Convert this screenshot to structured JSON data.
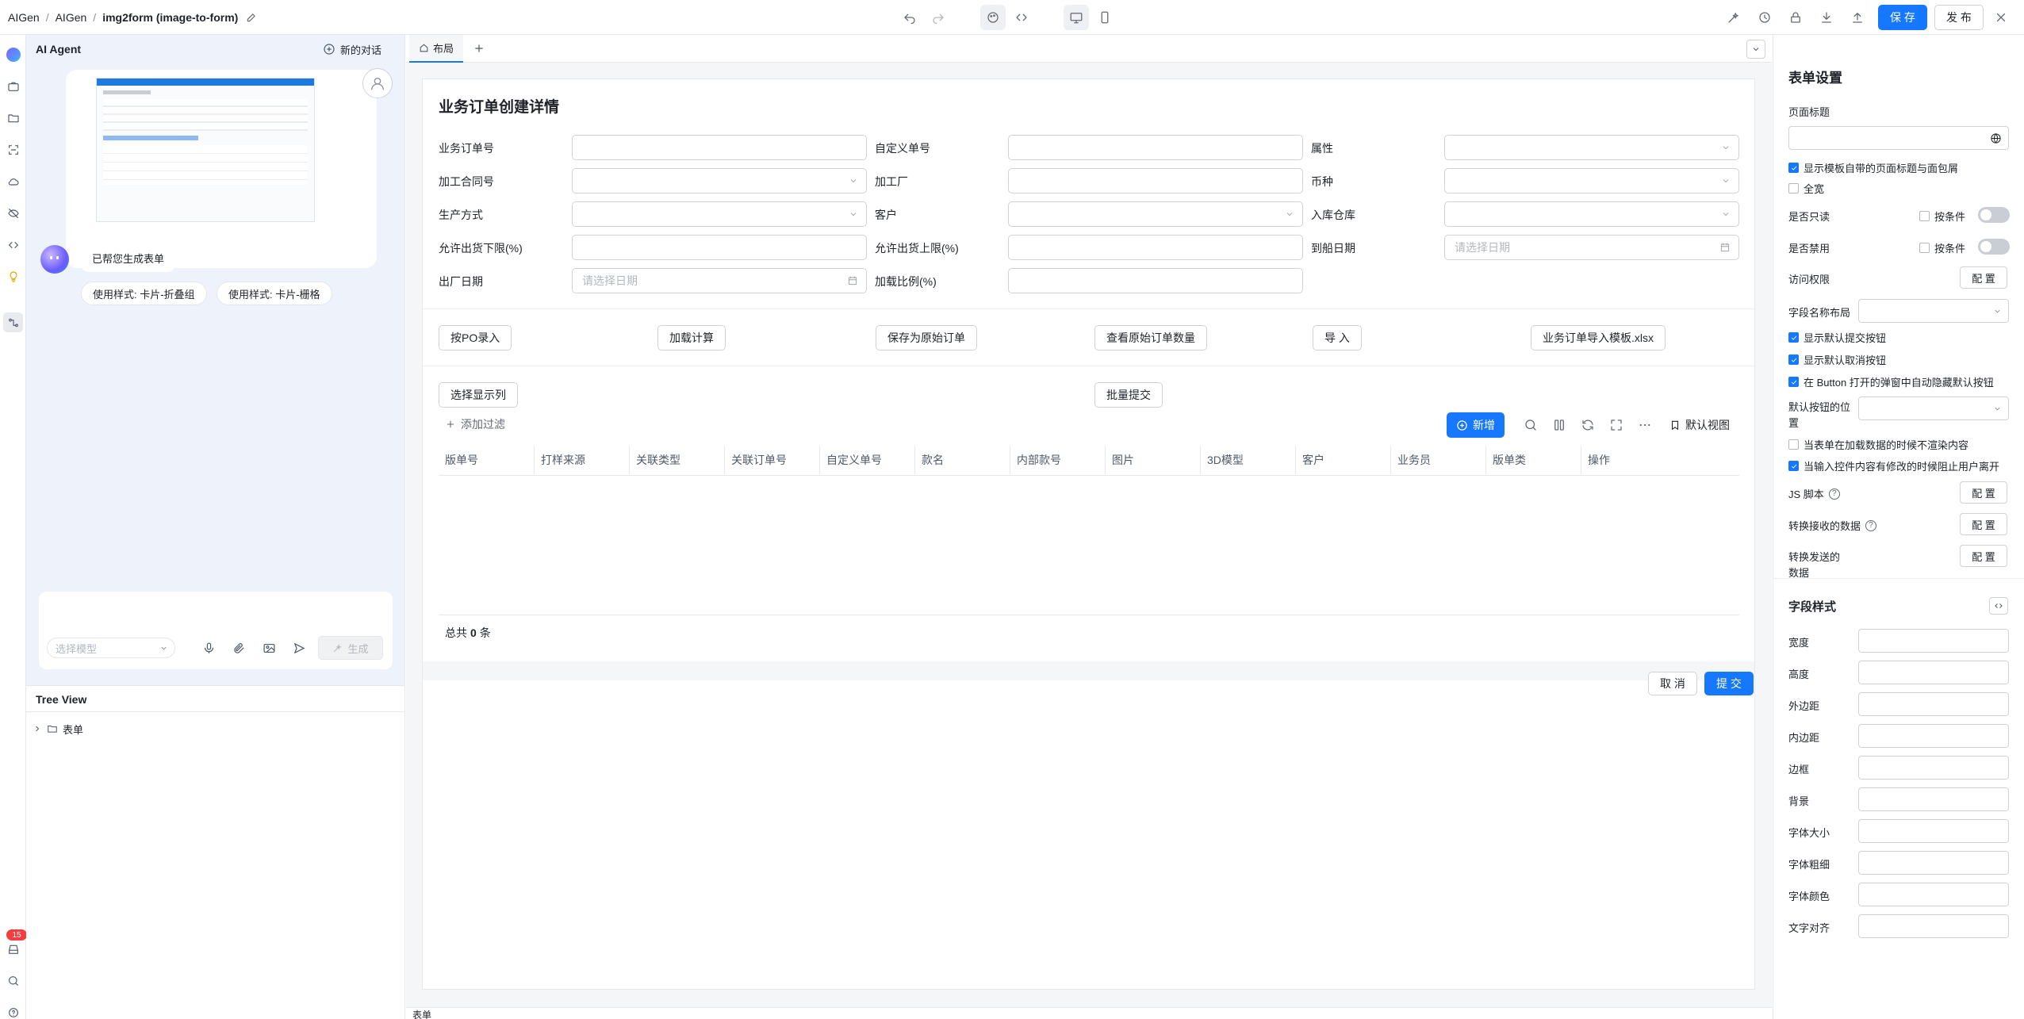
{
  "breadcrumb": {
    "root": "AIGen",
    "sep": "/",
    "parent": "AIGen",
    "current": "img2form (image-to-form)"
  },
  "toolbar": {
    "save_label": "保 存",
    "publish_label": "发 布"
  },
  "agent": {
    "title": "AI Agent",
    "new_chat_label": "新的对话",
    "bot_message": "已帮您生成表单",
    "suggestions": [
      "使用样式: 卡片-折叠组",
      "使用样式: 卡片-栅格"
    ],
    "model_placeholder": "选择模型",
    "generate_label": "生成",
    "notification_count": "15"
  },
  "tree": {
    "title": "Tree View",
    "root_label": "表单"
  },
  "canvas": {
    "tab_label": "布局",
    "status_label": "表单",
    "form_title": "业务订单创建详情",
    "fields_row1": [
      "业务订单号",
      "自定义单号",
      "属性"
    ],
    "fields_row2": [
      "加工合同号",
      "加工厂",
      "币种"
    ],
    "fields_row3": [
      "生产方式",
      "客户",
      "入库仓库"
    ],
    "fields_row4": [
      "允许出货下限(%)",
      "允许出货上限(%)",
      "到船日期"
    ],
    "fields_row5": [
      "出厂日期",
      "加载比例(%)"
    ],
    "date_placeholder": "请选择日期",
    "action_buttons": [
      "按PO录入",
      "加载计算",
      "保存为原始订单",
      "查看原始订单数量",
      "导 入",
      "业务订单导入模板.xlsx"
    ],
    "select_columns_label": "选择显示列",
    "batch_submit_label": "批量提交",
    "add_filter_label": "添加过滤",
    "new_label": "新增",
    "default_view_label": "默认视图",
    "columns": [
      "版单号",
      "打样来源",
      "关联类型",
      "关联订单号",
      "自定义单号",
      "款名",
      "内部款号",
      "图片",
      "3D模型",
      "客户",
      "业务员",
      "版单类",
      "操作"
    ],
    "total_prefix": "总共",
    "total_count": "0",
    "total_suffix": "条",
    "cancel_label": "取 消",
    "submit_label": "提 交"
  },
  "settings": {
    "title": "表单设置",
    "page_title_label": "页面标题",
    "show_template_header": "显示模板自带的页面标题与面包屑",
    "show_template_header_checked": true,
    "full_width": "全宽",
    "full_width_checked": false,
    "readonly_label": "是否只读",
    "disabled_label": "是否禁用",
    "by_condition": "按条件",
    "access_label": "访问权限",
    "config_label": "配 置",
    "field_layout_label": "字段名称布局",
    "show_submit": "显示默认提交按钮",
    "show_cancel": "显示默认取消按钮",
    "auto_hide": "在 Button 打开的弹窗中自动隐藏默认按钮",
    "default_btn_pos_label": "默认按钮的位置",
    "no_render_loading": "当表单在加载数据的时候不渲染内容",
    "prevent_leave": "当输入控件内容有修改的时候阻止用户离开",
    "js_script_label": "JS 脚本",
    "convert_recv_label": "转换接收的数据",
    "convert_send_label": "转换发送的数据",
    "field_style_title": "字段样式",
    "style_fields": [
      "宽度",
      "高度",
      "外边距",
      "内边距",
      "边框",
      "背景",
      "字体大小",
      "字体粗细",
      "字体颜色",
      "文字对齐"
    ]
  }
}
